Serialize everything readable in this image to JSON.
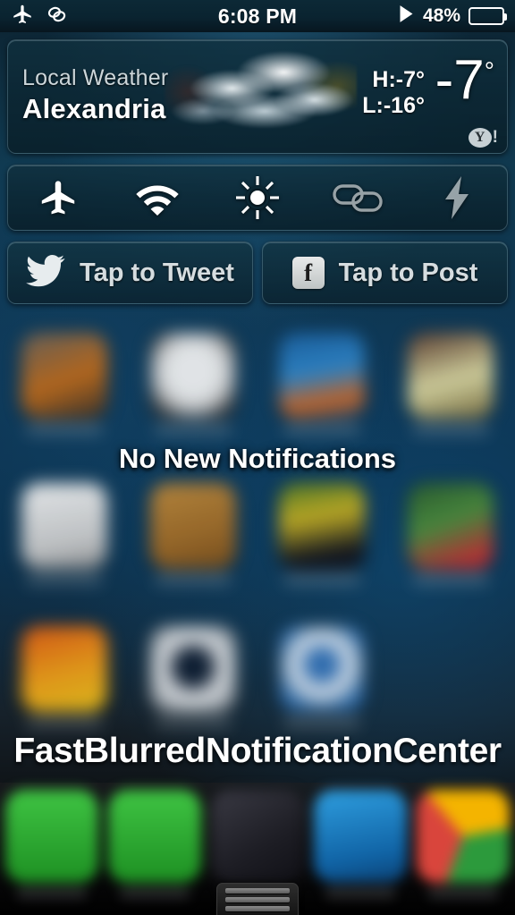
{
  "status_bar": {
    "left_icons": [
      "airplane-icon",
      "link-icon"
    ],
    "time": "6:08 PM",
    "play_icon": "play-icon",
    "battery_percent_label": "48%",
    "battery_level": 48
  },
  "weather_widget": {
    "section_label": "Local Weather",
    "city": "Alexandria",
    "high_label": "H:-7°",
    "low_label": "L:-16°",
    "current_temp": "-7",
    "degree_symbol": "°",
    "condition_icon": "cloud-icon",
    "provider_logo": "yahoo-logo",
    "provider_mark": "Y",
    "provider_bang": "!"
  },
  "toggles": [
    {
      "name": "airplane-mode-toggle",
      "icon": "airplane-icon",
      "state": "on"
    },
    {
      "name": "wifi-toggle",
      "icon": "wifi-icon",
      "state": "on"
    },
    {
      "name": "brightness-toggle",
      "icon": "brightness-sun-icon",
      "state": "on"
    },
    {
      "name": "link-toggle",
      "icon": "link-chain-icon",
      "state": "off"
    },
    {
      "name": "flashlight-toggle",
      "icon": "lightning-bolt-icon",
      "state": "off"
    }
  ],
  "social": {
    "tweet_label": "Tap to Tweet",
    "tweet_icon": "twitter-bird-icon",
    "post_label": "Tap to Post",
    "post_icon": "facebook-f-icon",
    "post_icon_glyph": "f"
  },
  "notifications": {
    "empty_message": "No New Notifications"
  },
  "tweak": {
    "title": "FastBlurredNotificationCenter"
  },
  "dock": {
    "items": [
      {
        "name": "dock-icon-phone",
        "color": "#2fae36"
      },
      {
        "name": "dock-icon-messages",
        "color": "#2fae36"
      },
      {
        "name": "dock-icon-folder",
        "color": "#2b2b30"
      },
      {
        "name": "dock-icon-blue-app",
        "color": "#1a7fc4"
      },
      {
        "name": "dock-icon-chrome",
        "color": "#d9453c"
      }
    ],
    "grabber": "notification-center-grabber"
  },
  "colors": {
    "panel_bg": "#103040",
    "panel_border": "#96becd",
    "text_primary": "#ffffff",
    "text_secondary": "#ccd6da",
    "wallpaper_blue": "#0d3350"
  }
}
